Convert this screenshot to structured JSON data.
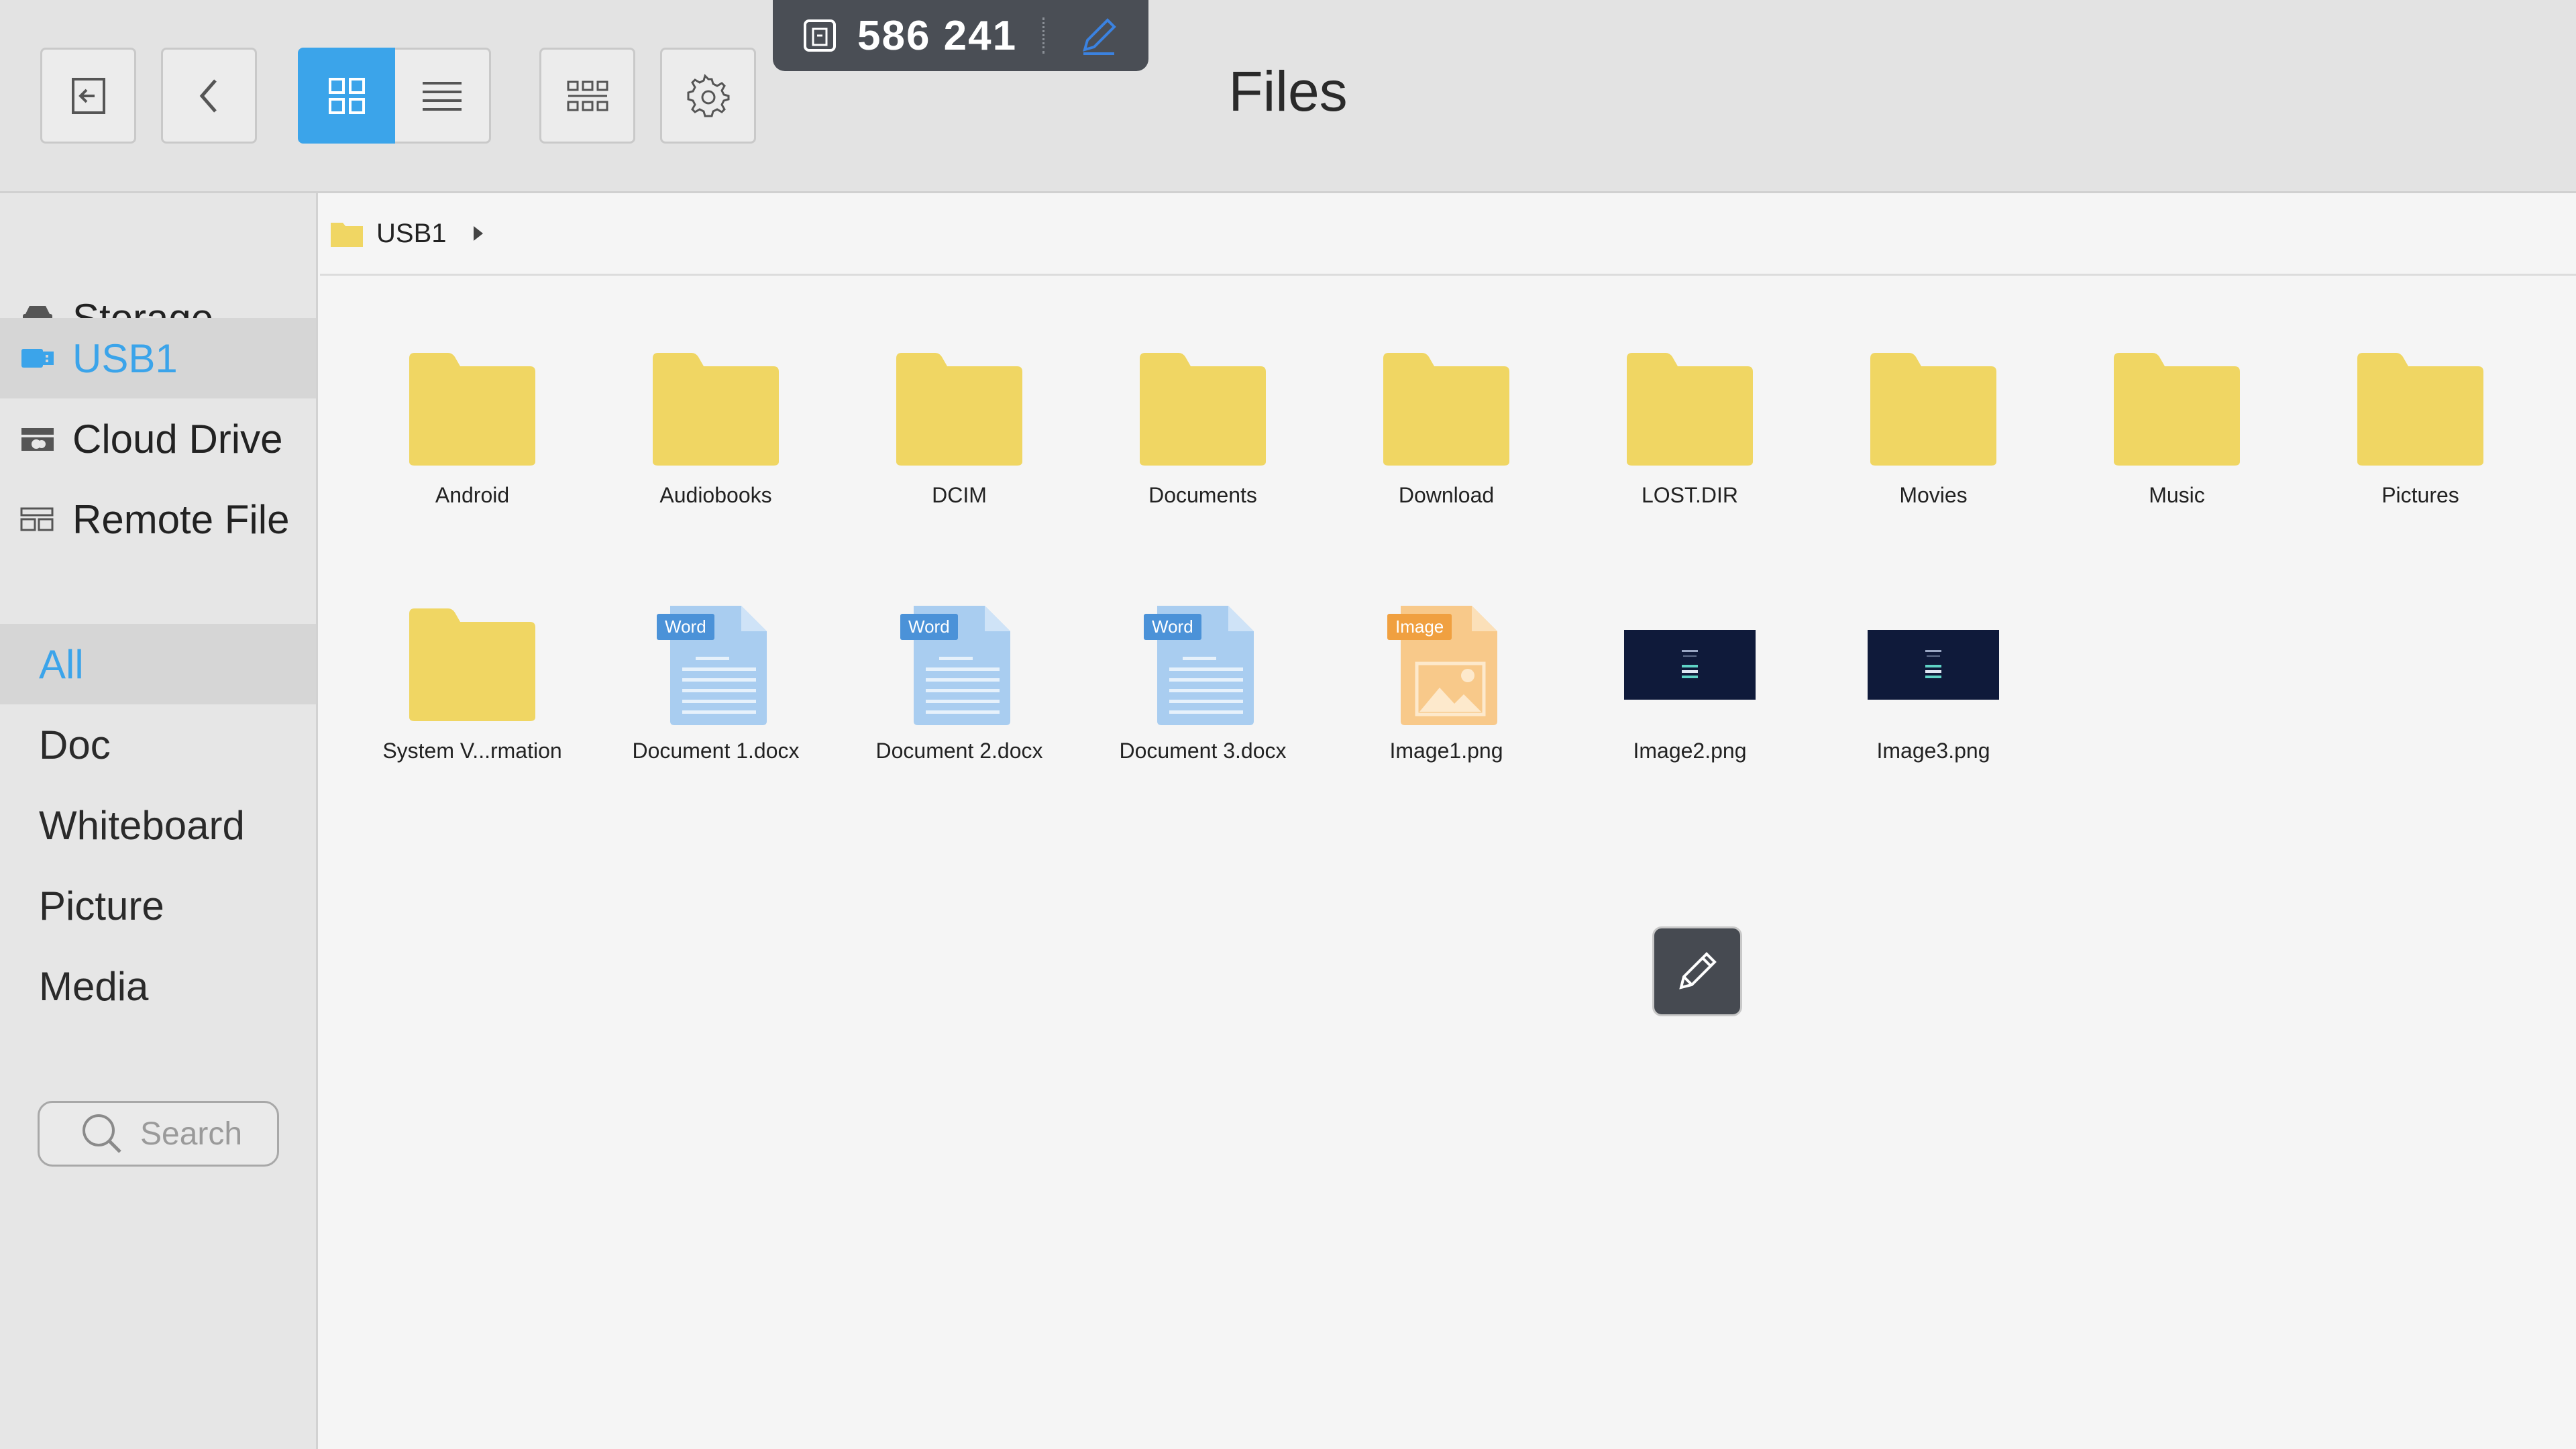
{
  "header": {
    "title": "Files",
    "buttons": {
      "exit": "exit-icon",
      "back": "back-icon",
      "grid_view": "grid-view-icon",
      "list_view": "list-view-icon",
      "multiselect": "multiselect-icon",
      "settings": "gear-icon"
    }
  },
  "floatbar": {
    "code": "586 241",
    "icon": "cast-icon",
    "edit_icon": "pen-icon"
  },
  "sidebar": {
    "storage": [
      {
        "label": "Storage",
        "icon": "drive-icon",
        "selected": false
      },
      {
        "label": "USB1",
        "icon": "usb-icon",
        "selected": true
      },
      {
        "label": "Cloud Drive",
        "icon": "cloud-drive-icon",
        "selected": false
      },
      {
        "label": "Remote File",
        "icon": "remote-file-icon",
        "selected": false
      }
    ],
    "categories": [
      {
        "label": "All",
        "selected": true
      },
      {
        "label": "Doc",
        "selected": false
      },
      {
        "label": "Whiteboard",
        "selected": false
      },
      {
        "label": "Picture",
        "selected": false
      },
      {
        "label": "Media",
        "selected": false
      }
    ],
    "search_label": "Search"
  },
  "breadcrumb": {
    "path": "USB1"
  },
  "files": [
    {
      "name": "Android",
      "type": "folder"
    },
    {
      "name": "Audiobooks",
      "type": "folder"
    },
    {
      "name": "DCIM",
      "type": "folder"
    },
    {
      "name": "Documents",
      "type": "folder"
    },
    {
      "name": "Download",
      "type": "folder"
    },
    {
      "name": "LOST.DIR",
      "type": "folder"
    },
    {
      "name": "Movies",
      "type": "folder"
    },
    {
      "name": "Music",
      "type": "folder"
    },
    {
      "name": "Pictures",
      "type": "folder"
    },
    {
      "name": "System V...rmation",
      "type": "folder"
    },
    {
      "name": "Document 1.docx",
      "type": "word",
      "tag": "Word"
    },
    {
      "name": "Document 2.docx",
      "type": "word",
      "tag": "Word"
    },
    {
      "name": "Document 3.docx",
      "type": "word",
      "tag": "Word"
    },
    {
      "name": "Image1.png",
      "type": "image",
      "tag": "Image"
    },
    {
      "name": "Image2.png",
      "type": "thumb"
    },
    {
      "name": "Image3.png",
      "type": "thumb"
    }
  ],
  "colors": {
    "accent": "#3ba4ea",
    "folder": "#f0d663",
    "word": "#a9cdf0",
    "word_tag": "#4b92d8",
    "image": "#f8c98a",
    "image_tag": "#f0a040"
  }
}
